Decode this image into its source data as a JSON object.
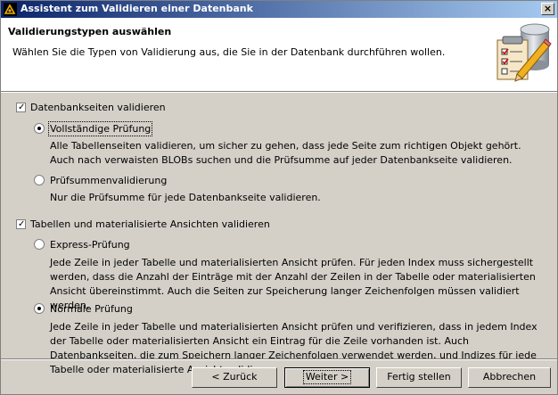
{
  "window": {
    "title": "Assistent zum Validieren einer Datenbank",
    "close_glyph": "×"
  },
  "header": {
    "title": "Validierungstypen auswählen",
    "description": "Wählen Sie die Typen von Validierung aus, die Sie in der Datenbank durchführen wollen."
  },
  "section1": {
    "checkbox_label": "Datenbankseiten validieren",
    "checked": true,
    "options": [
      {
        "label": "Vollständige Prüfung",
        "selected": true,
        "description": "Alle Tabellenseiten validieren, um sicher zu gehen, dass jede Seite zum richtigen Objekt gehört. Auch nach verwaisten BLOBs suchen und die Prüfsumme auf jeder Datenbankseite validieren."
      },
      {
        "label": "Prüfsummenvalidierung",
        "selected": false,
        "description": "Nur die Prüfsumme für jede Datenbankseite validieren."
      }
    ]
  },
  "section2": {
    "checkbox_label": "Tabellen und materialisierte Ansichten validieren",
    "checked": true,
    "options": [
      {
        "label": "Express-Prüfung",
        "selected": false,
        "description": "Jede Zeile in jeder Tabelle und materialisierten Ansicht prüfen. Für jeden Index muss sichergestellt werden, dass die Anzahl der Einträge mit der Anzahl der Zeilen in der Tabelle oder materialisierten Ansicht übereinstimmt. Auch die Seiten zur Speicherung langer Zeichenfolgen müssen validiert werden."
      },
      {
        "label": "Normale Prüfung",
        "selected": true,
        "description": "Jede Zeile in jeder Tabelle und materialisierten Ansicht prüfen und verifizieren, dass in jedem Index der Tabelle oder materialisierten Ansicht ein Eintrag für die Zeile vorhanden ist. Auch Datenbankseiten, die zum Speichern langer Zeichenfolgen verwendet werden, und Indizes für jede Tabelle oder materialisierte Ansicht validieren."
      }
    ]
  },
  "buttons": {
    "back": "< Zurück",
    "next": "Weiter >",
    "finish": "Fertig stellen",
    "cancel": "Abbrechen"
  }
}
